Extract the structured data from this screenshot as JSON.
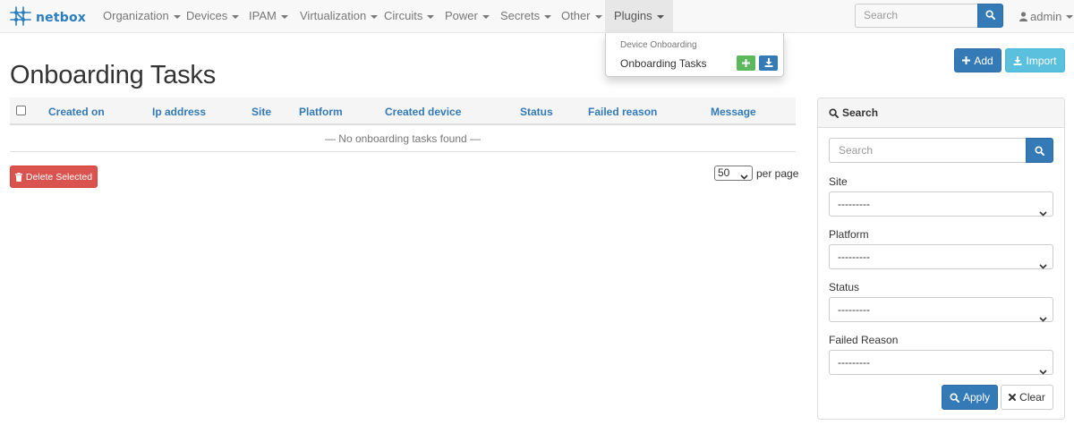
{
  "navbar": {
    "brand": "netbox",
    "menu": [
      {
        "label": "Organization"
      },
      {
        "label": "Devices"
      },
      {
        "label": "IPAM"
      },
      {
        "label": "Virtualization"
      },
      {
        "label": "Circuits"
      },
      {
        "label": "Power"
      },
      {
        "label": "Secrets"
      },
      {
        "label": "Other"
      },
      {
        "label": "Plugins"
      }
    ],
    "search_placeholder": "Search",
    "user": "admin"
  },
  "dropdown": {
    "header": "Device Onboarding",
    "link": "Onboarding Tasks"
  },
  "header": {
    "title": "Onboarding Tasks",
    "add_label": "Add",
    "import_label": "Import"
  },
  "table": {
    "columns": [
      "Created on",
      "Ip address",
      "Site",
      "Platform",
      "Created device",
      "Status",
      "Failed reason",
      "Message"
    ],
    "empty_text": "— No onboarding tasks found —"
  },
  "actions": {
    "delete_label": "Delete Selected",
    "per_page_value": "50",
    "per_page_label": "per page"
  },
  "search_panel": {
    "title": "Search",
    "search_placeholder": "Search",
    "filters": [
      {
        "label": "Site",
        "value": "---------"
      },
      {
        "label": "Platform",
        "value": "---------"
      },
      {
        "label": "Status",
        "value": "---------"
      },
      {
        "label": "Failed Reason",
        "value": "---------"
      }
    ],
    "apply_label": "Apply",
    "clear_label": "Clear"
  },
  "colors": {
    "primary": "#337ab7",
    "success": "#5cb85c",
    "info": "#5bc0de",
    "danger": "#d9534f",
    "navbar_bg": "#f8f8f8"
  },
  "icons": [
    "netbox-logo-icon",
    "search-icon",
    "user-icon",
    "plus-icon",
    "import-icon",
    "trash-icon",
    "chevron-down-icon",
    "times-icon"
  ]
}
